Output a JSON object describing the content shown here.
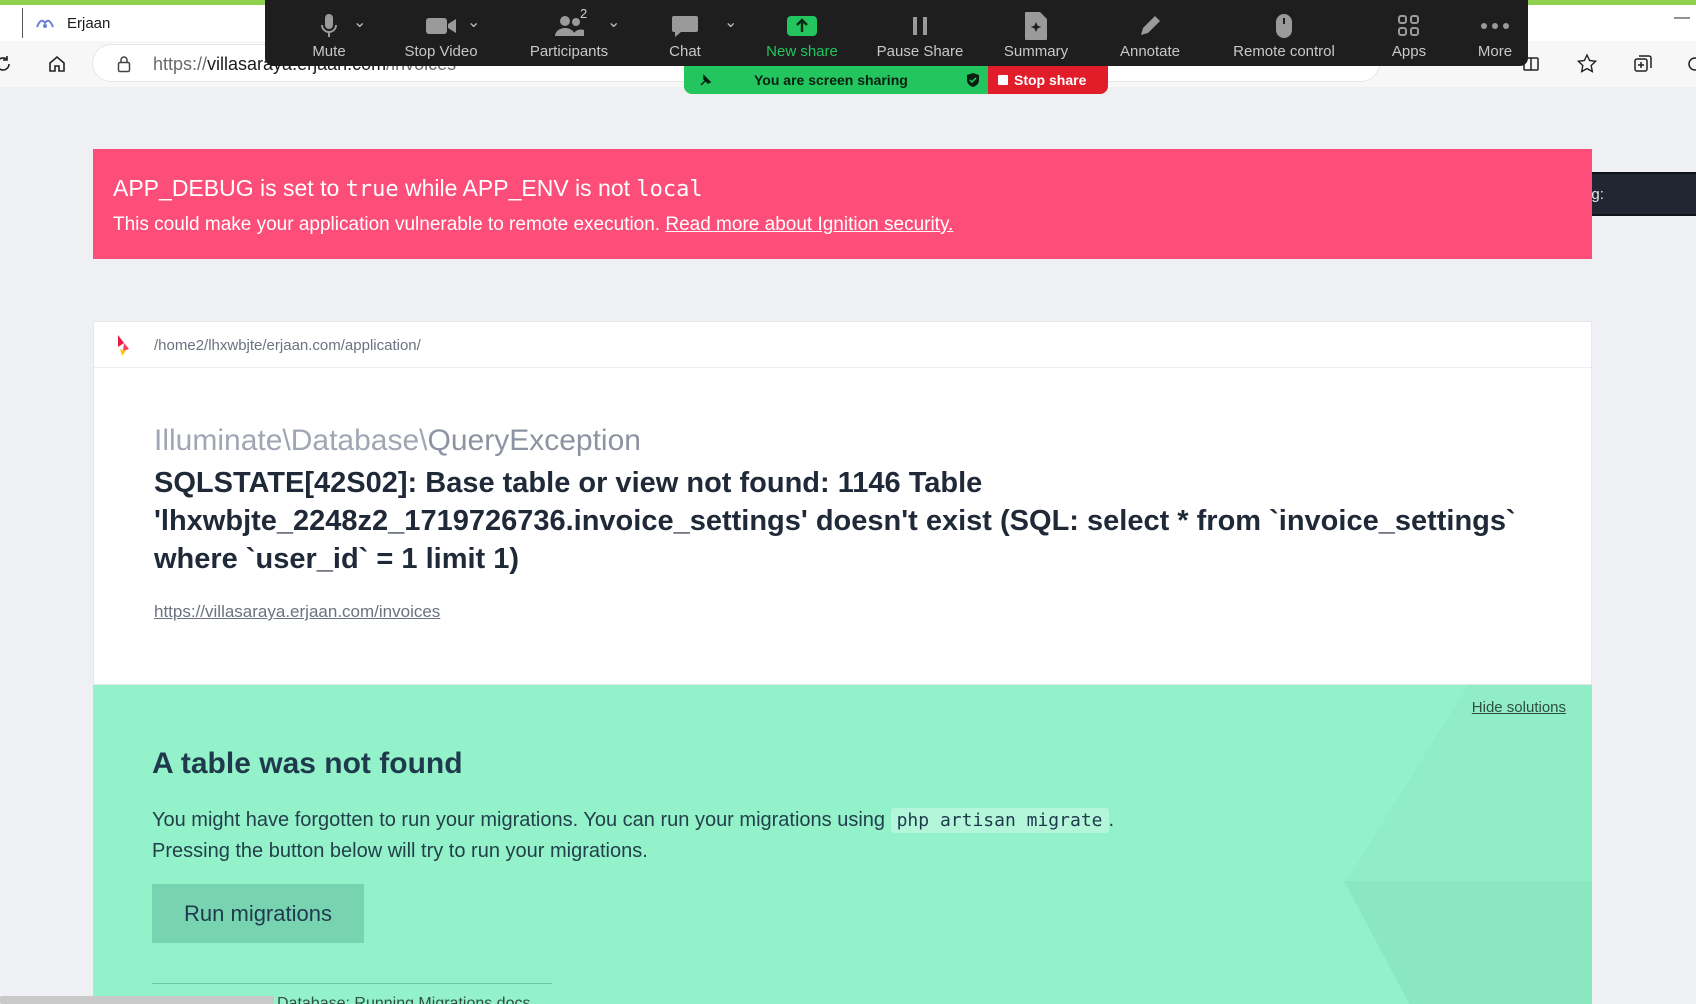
{
  "browser": {
    "tab_title": "Erjaan",
    "url_scheme": "https://",
    "url_host": "villasaraya.erjaan.com",
    "url_path": "/invoices"
  },
  "zoom": {
    "items": [
      {
        "label": "Mute",
        "icon": "microphone-icon"
      },
      {
        "label": "Stop Video",
        "icon": "video-camera-icon"
      },
      {
        "label": "Participants",
        "icon": "participants-icon",
        "badge": "2"
      },
      {
        "label": "Chat",
        "icon": "chat-icon"
      },
      {
        "label": "New share",
        "icon": "share-up-arrow-icon"
      },
      {
        "label": "Pause Share",
        "icon": "pause-icon"
      },
      {
        "label": "Summary",
        "icon": "summary-icon"
      },
      {
        "label": "Annotate",
        "icon": "pencil-icon"
      },
      {
        "label": "Remote control",
        "icon": "mouse-icon"
      },
      {
        "label": "Apps",
        "icon": "apps-icon"
      },
      {
        "label": "More",
        "icon": "more-dots-icon"
      }
    ],
    "sharing_text": "You are screen sharing",
    "stop_share": "Stop share",
    "talking": "Talking:",
    "accent_green": "#22c55e",
    "stop_red": "#e11d2a"
  },
  "banner": {
    "part1": "APP_DEBUG is set to ",
    "code1": "true",
    "part2": " while APP_ENV is not ",
    "code2": "local",
    "line2": "This could make your application vulnerable to remote execution. ",
    "link": "Read more about Ignition security.",
    "color": "#fd4d79"
  },
  "error": {
    "app_path": "/home2/lhxwbjte/erjaan.com/application/",
    "class_prefix": "Illuminate\\Database\\",
    "class_last": "QueryException",
    "message": "SQLSTATE[42S02]: Base table or view not found: 1146 Table 'lhxwbjte_2248z2_1719726736.invoice_settings' doesn't exist (SQL: select * from `invoice_settings` where `user_id` = 1 limit 1)",
    "url": "https://villasaraya.erjaan.com/invoices"
  },
  "solution": {
    "hide": "Hide solutions",
    "title": "A table was not found",
    "text1_a": "You might have forgotten to run your migrations. You can run your migrations using ",
    "text1_code": "php artisan migrate",
    "text1_b": ".",
    "text2": "Pressing the button below will try to run your migrations.",
    "button": "Run migrations",
    "partial": "Database: Running Migrations docs",
    "color": "#94f2ca"
  }
}
